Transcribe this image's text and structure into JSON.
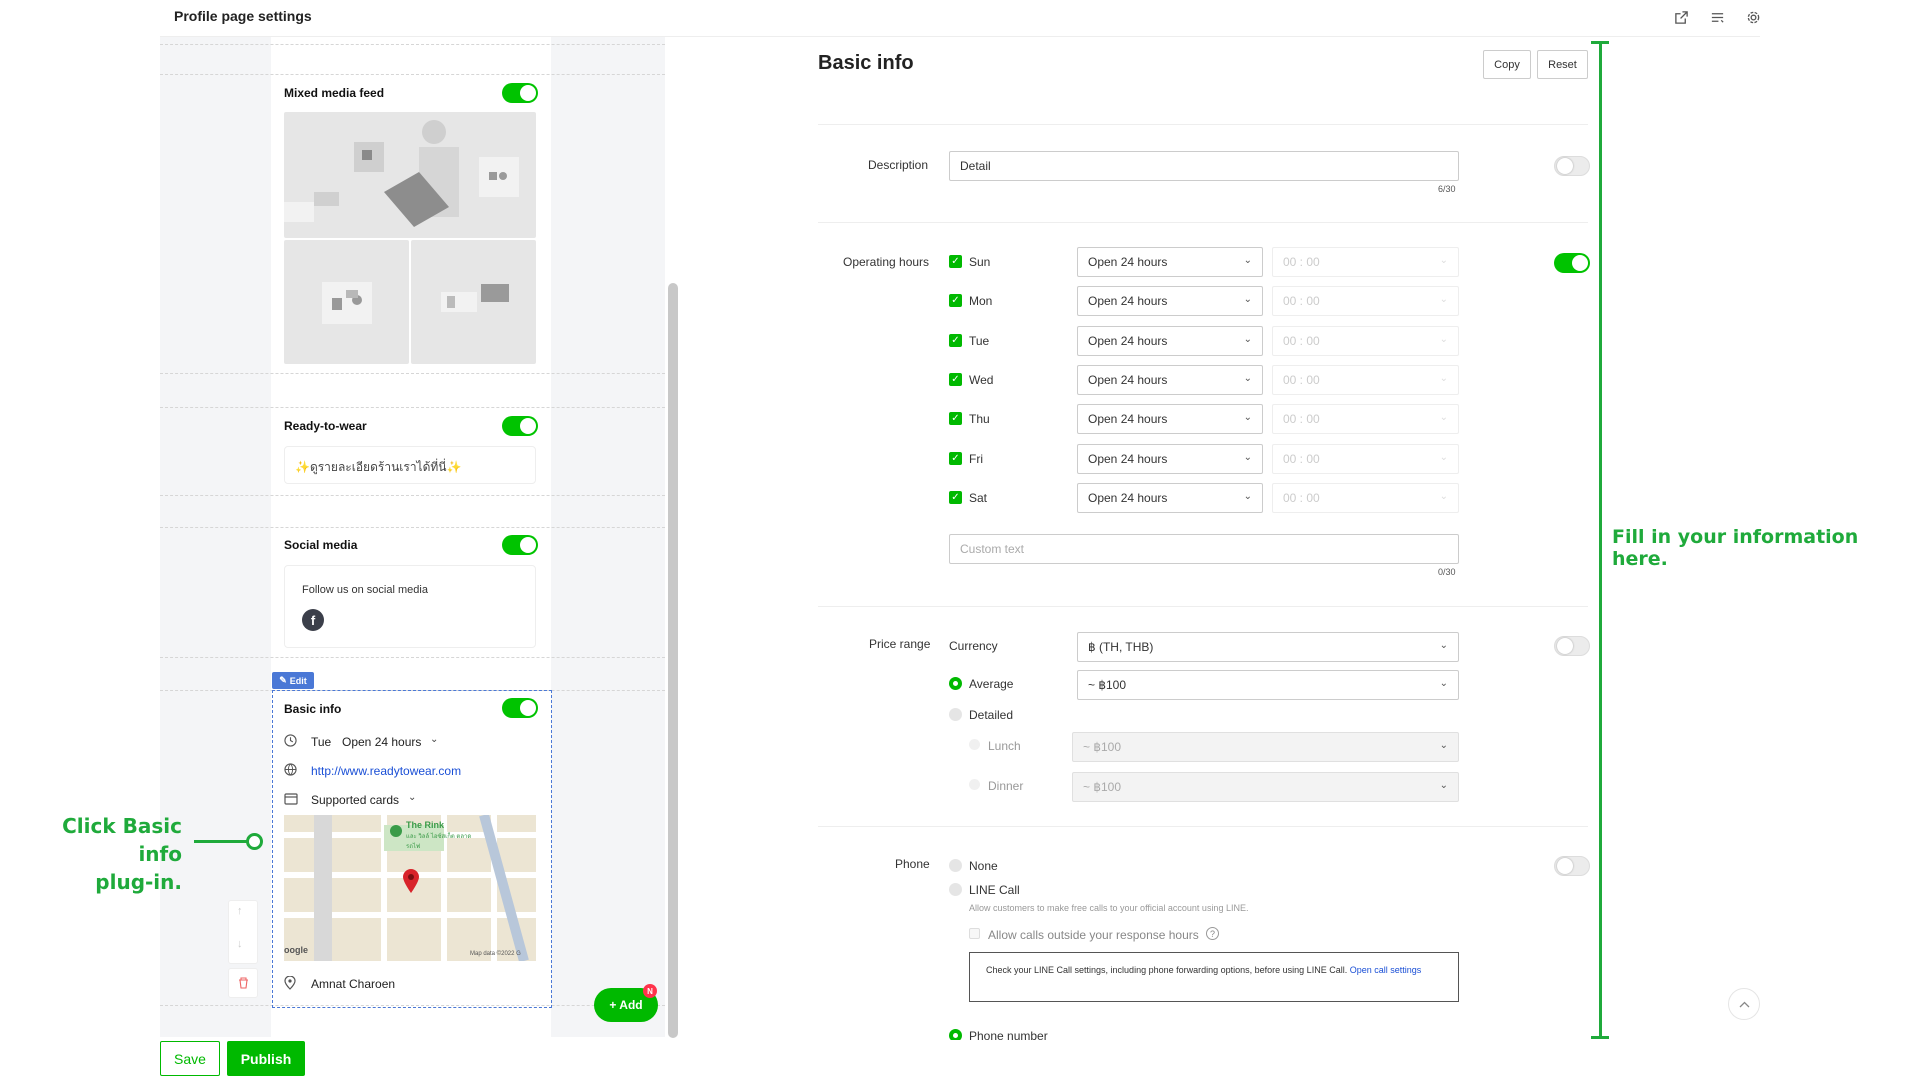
{
  "header": {
    "title": "Profile page settings"
  },
  "preview": {
    "mixed_media": {
      "title": "Mixed media feed"
    },
    "ready": {
      "title": "Ready-to-wear",
      "text": "✨ดูรายละเอียดร้านเราได้ที่นี่✨"
    },
    "social": {
      "title": "Social media",
      "text": "Follow us on social media"
    },
    "basic": {
      "edit_label": "Edit",
      "title": "Basic info",
      "day": "Tue",
      "hours": "Open 24 hours",
      "url": "http://www.readytowear.com",
      "cards": "Supported cards",
      "map_place": "The Rink",
      "map_sub": "และ วิลล์ ไอซ์สเก็ต ตลาดรถไฟ",
      "map_data": "Map data ©2022 G",
      "map_brand": "oogle",
      "address": "Amnat Charoen"
    },
    "add_label": "+ Add",
    "add_badge": "N"
  },
  "footer": {
    "save": "Save",
    "publish": "Publish"
  },
  "form": {
    "title": "Basic info",
    "copy": "Copy",
    "reset": "Reset",
    "description": {
      "label": "Description",
      "value": "Detail",
      "count": "6/30"
    },
    "hours": {
      "label": "Operating hours",
      "days": [
        "Sun",
        "Mon",
        "Tue",
        "Wed",
        "Thu",
        "Fri",
        "Sat"
      ],
      "mode": "Open 24 hours",
      "time": "00 : 00",
      "custom_placeholder": "Custom text",
      "count": "0/30"
    },
    "price": {
      "label": "Price range",
      "currency_label": "Currency",
      "currency": "฿ (TH, THB)",
      "average": "Average",
      "average_value": "~ ฿100",
      "detailed": "Detailed",
      "lunch": "Lunch",
      "lunch_value": "~ ฿100",
      "dinner": "Dinner",
      "dinner_value": "~ ฿100"
    },
    "phone": {
      "label": "Phone",
      "none": "None",
      "line_call": "LINE Call",
      "line_call_help": "Allow customers to make free calls to your official account using LINE.",
      "allow_outside": "Allow calls outside your response hours",
      "notice": "Check your LINE Call settings, including phone forwarding options, before using LINE Call.",
      "notice_link": "Open call settings",
      "phone_number": "Phone number"
    }
  },
  "annotations": {
    "click_line1": "Click Basic info",
    "click_line2": "plug-in.",
    "fill": "Fill in your information here."
  },
  "colors": {
    "accent": "#00c300",
    "annotation": "#1faa3b",
    "link": "#1a4fd6"
  }
}
